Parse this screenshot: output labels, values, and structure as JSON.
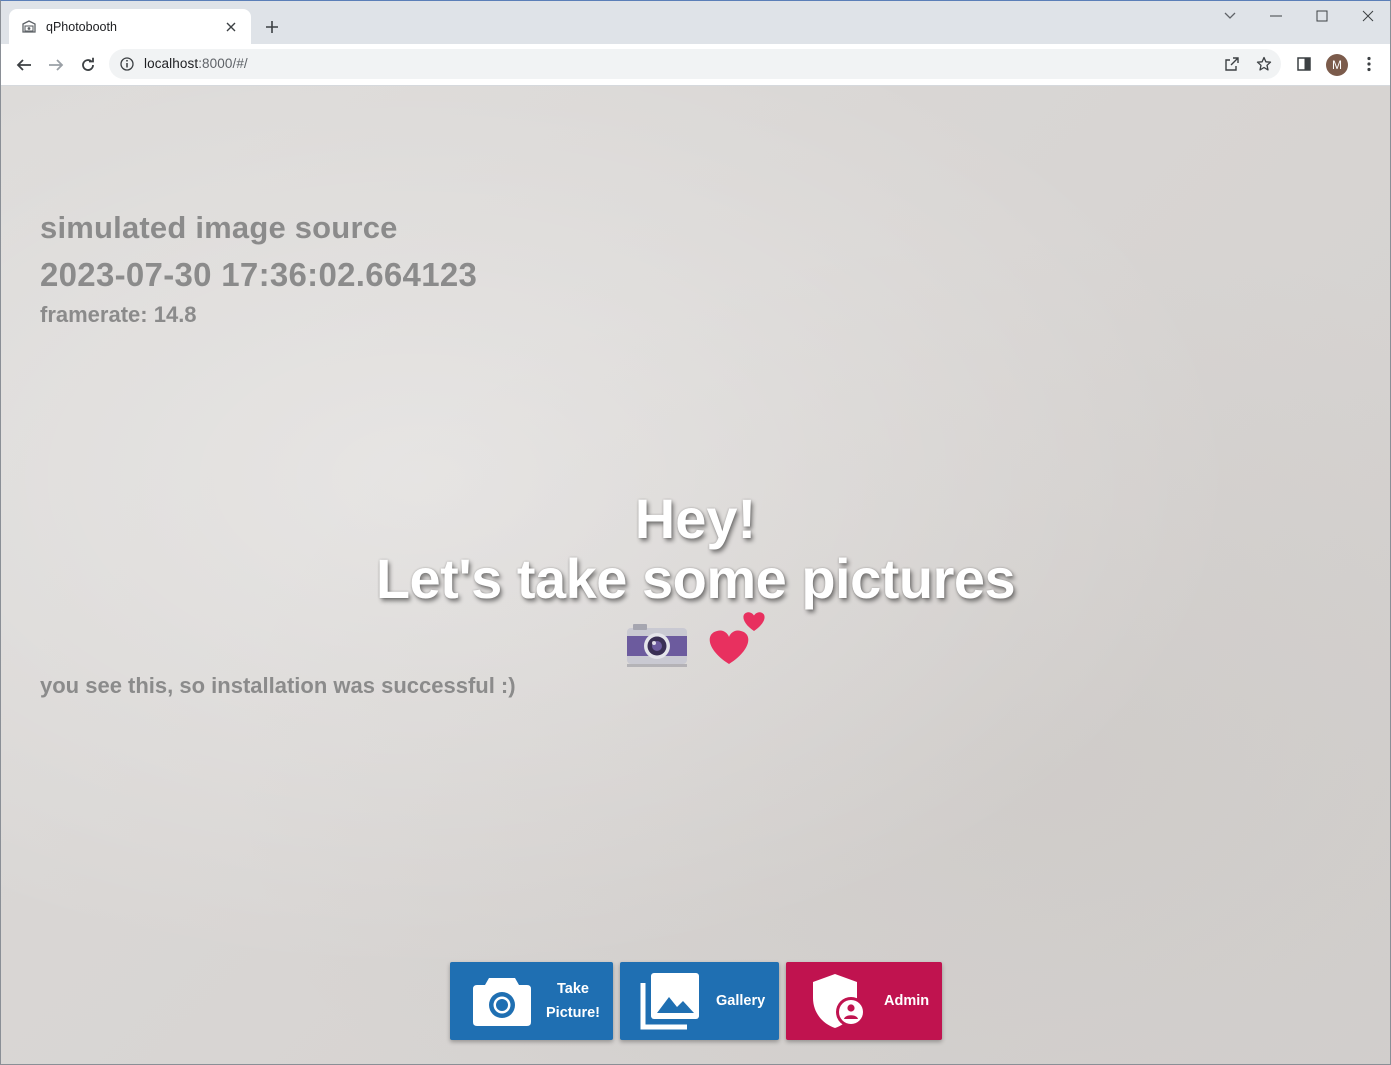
{
  "browser": {
    "tab_title": "qPhotobooth",
    "url_host": "localhost",
    "url_path": ":8000/#/",
    "avatar_initial": "M"
  },
  "page": {
    "source_label": "simulated image source",
    "timestamp": "2023-07-30 17:36:02.664123",
    "framerate": "framerate: 14.8",
    "success_msg": "you see this, so installation was successful :)",
    "headline_1": "Hey!",
    "headline_2": "Let's take some pictures",
    "emoji_icons": [
      "camera-icon",
      "two-hearts-icon"
    ]
  },
  "buttons": {
    "take_picture_line1": "Take",
    "take_picture_line2": "Picture!",
    "gallery": "Gallery",
    "admin": "Admin"
  },
  "colors": {
    "primary": "#1f6fb2",
    "admin": "#c0134f",
    "overlay_text": "#8b8b8b"
  }
}
